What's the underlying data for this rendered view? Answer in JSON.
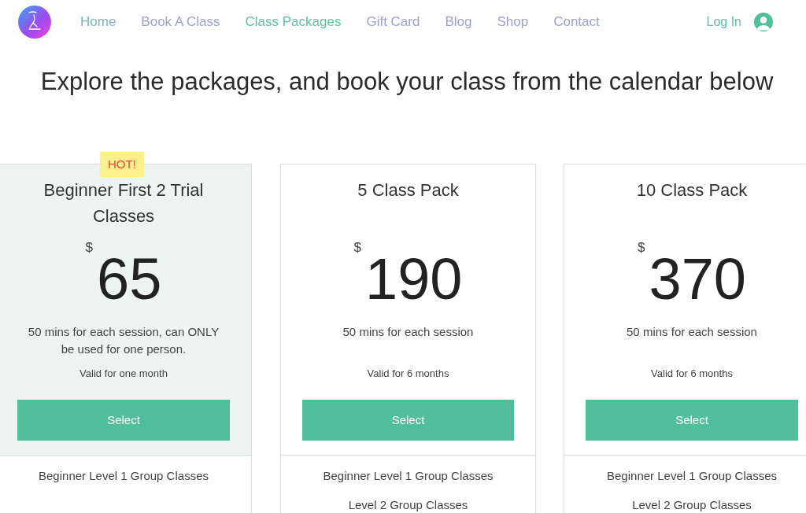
{
  "header": {
    "nav": [
      {
        "label": "Home",
        "selected": false,
        "color": "#7fb2c6"
      },
      {
        "label": "Book A Class",
        "selected": false,
        "color": "#9d9fcf"
      },
      {
        "label": "Class Packages",
        "selected": true
      },
      {
        "label": "Gift Card",
        "selected": false,
        "color": "#9d9fcf"
      },
      {
        "label": "Blog",
        "selected": false,
        "color": "#9d9fcf"
      },
      {
        "label": "Shop",
        "selected": false,
        "color": "#9d9fcf"
      },
      {
        "label": "Contact",
        "selected": false,
        "color": "#9d9fcf"
      }
    ],
    "login": "Log In"
  },
  "subtitle": "Explore the packages, and book your class from the calendar below",
  "packages": [
    {
      "badge": "HOT!",
      "highlighted": true,
      "title": "Beginner First 2 Trial Classes",
      "currency": "$",
      "price": "65",
      "description": "50 mins for each session, can ONLY be used for one person.",
      "validity": "Valid for one month",
      "button": "Select",
      "features": [
        "Beginner Level 1 Group Classes"
      ]
    },
    {
      "highlighted": false,
      "title": "5 Class Pack",
      "currency": "$",
      "price": "190",
      "description": "50 mins for each session",
      "validity": "Valid for 6 months",
      "button": "Select",
      "features": [
        "Beginner Level 1 Group Classes",
        "Level 2 Group Classes"
      ]
    },
    {
      "highlighted": false,
      "title": "10 Class Pack",
      "currency": "$",
      "price": "370",
      "description": "50 mins for each session",
      "validity": "Valid for 6 months",
      "button": "Select",
      "features": [
        "Beginner Level 1 Group Classes",
        "Level 2 Group Classes"
      ]
    }
  ]
}
